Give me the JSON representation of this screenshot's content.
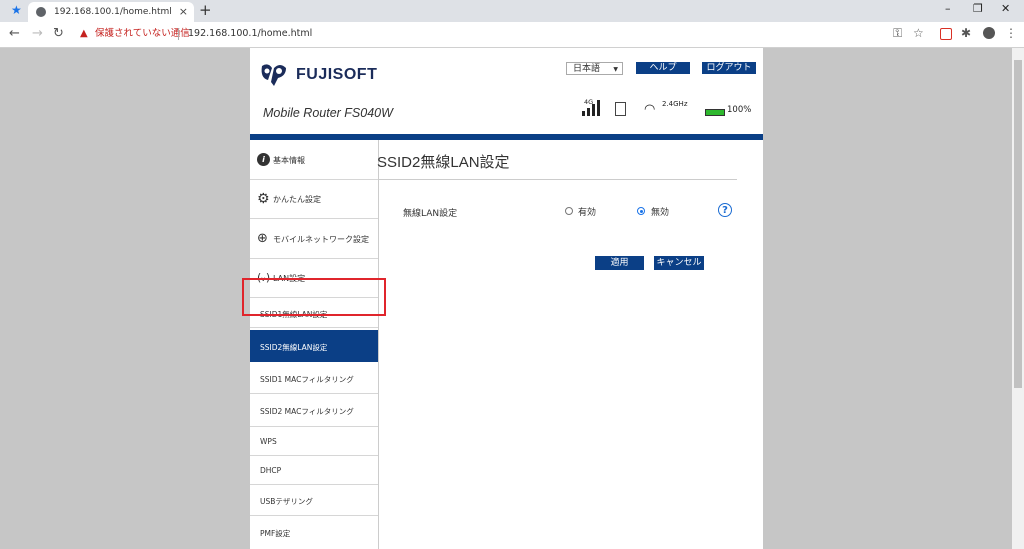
{
  "browser": {
    "tab_title": "192.168.100.1/home.html",
    "close_tab": "×",
    "new_tab": "+",
    "security_warning": "保護されていない通信",
    "url": "192.168.100.1/home.html",
    "window_controls": [
      "–",
      "❐",
      "✕"
    ]
  },
  "header": {
    "brand": "FUJISOFT",
    "model": "Mobile Router FS040W",
    "language": "日本語",
    "help_button": "ヘルプ",
    "logout_button": "ログアウト",
    "signal_type": "4G",
    "wifi_band": "2.4GHz",
    "battery": "100%",
    "brand_color": "#0b3f86"
  },
  "sidebar": {
    "items": [
      {
        "label": "基本情報",
        "icon": "info-icon"
      },
      {
        "label": "かんたん設定",
        "icon": "gear-icon"
      },
      {
        "label": "モバイルネットワーク設定",
        "icon": "globe-icon"
      },
      {
        "label": "LAN設定",
        "icon": "antenna-icon"
      }
    ],
    "sub_items": [
      {
        "label": "SSID1無線LAN設定"
      },
      {
        "label": "SSID2無線LAN設定",
        "active": true
      },
      {
        "label": "SSID1 MACフィルタリング"
      },
      {
        "label": "SSID2 MACフィルタリング"
      },
      {
        "label": "WPS"
      },
      {
        "label": "DHCP"
      },
      {
        "label": "USBテザリング"
      },
      {
        "label": "PMF設定"
      }
    ]
  },
  "content": {
    "title": "SSID2無線LAN設定",
    "setting_label": "無線LAN設定",
    "option_enabled": "有効",
    "option_disabled": "無効",
    "selected": "無効",
    "help": "?",
    "apply_button": "適用",
    "cancel_button": "キャンセル"
  },
  "annotation_color": "#e0252c"
}
